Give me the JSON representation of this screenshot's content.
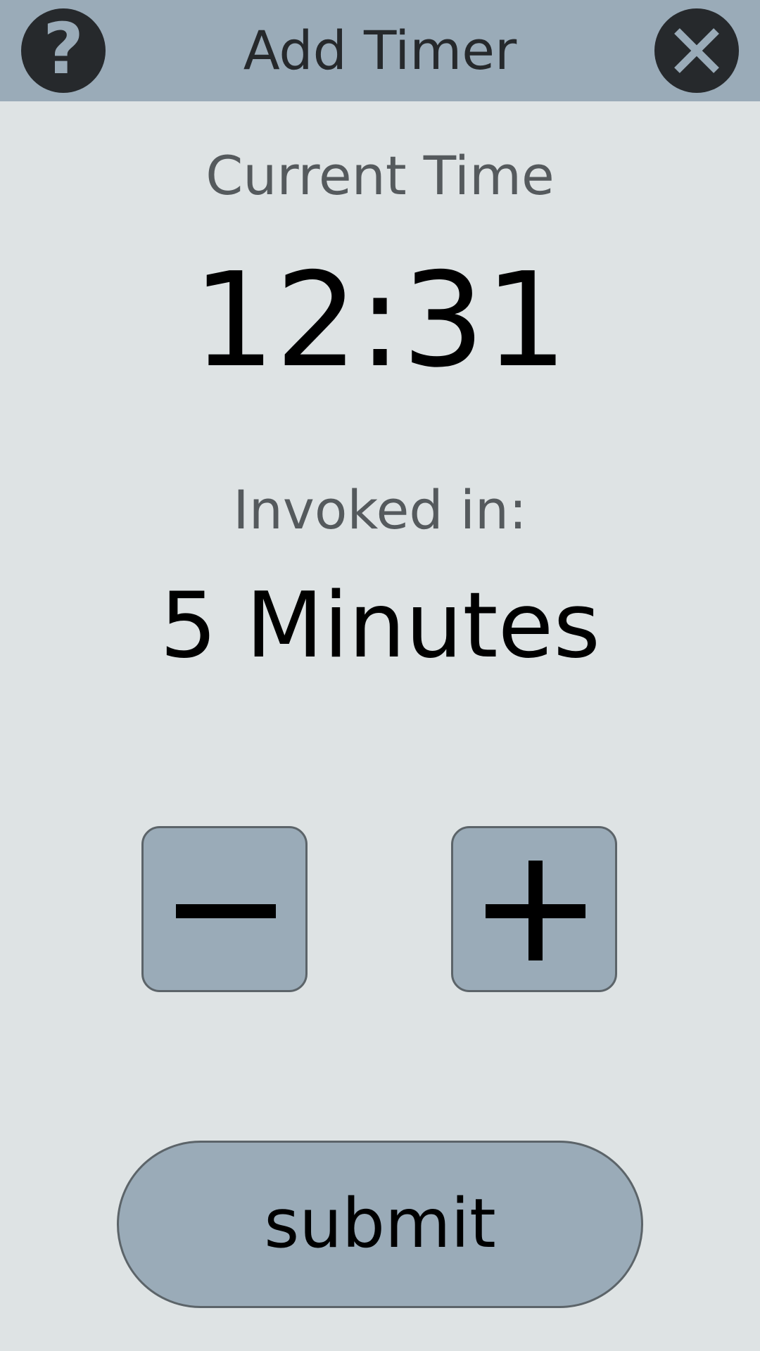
{
  "header": {
    "title": "Add Timer",
    "help_icon": "question-mark-icon",
    "help_glyph": "?",
    "close_icon": "close-x-icon"
  },
  "current_time": {
    "label": "Current Time",
    "value": "12:31"
  },
  "invoked": {
    "label": "Invoked in:",
    "value": "5 Minutes"
  },
  "controls": {
    "decrement_icon": "minus-icon",
    "increment_icon": "plus-icon"
  },
  "submit": {
    "label": "submit"
  },
  "colors": {
    "background": "#dee3e4",
    "header": "#9aabb8",
    "dark": "#26292c",
    "button_fill": "#9aabb8",
    "button_border": "#5c6469",
    "secondary_text": "#555a5d"
  }
}
